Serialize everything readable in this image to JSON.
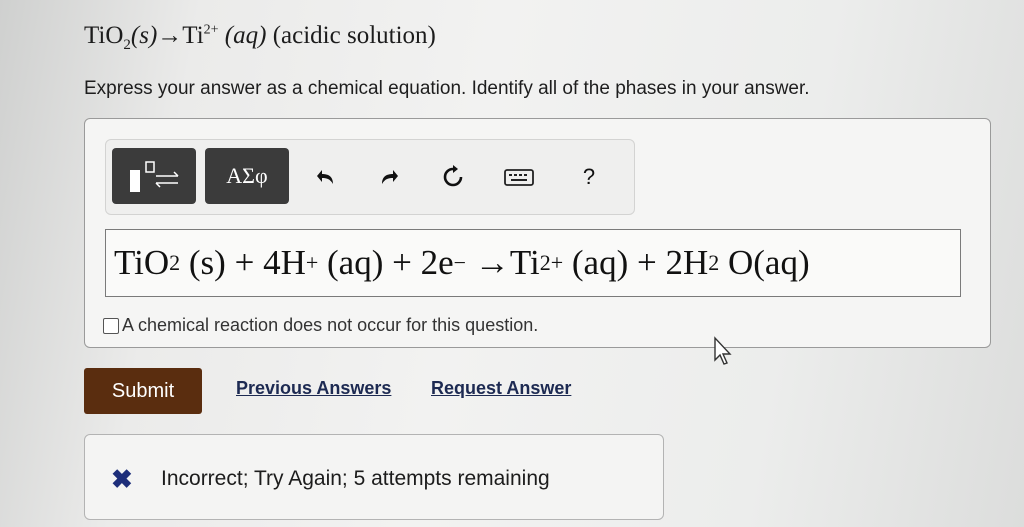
{
  "question": {
    "reactant": "TiO",
    "reactant_sub": "2",
    "reactant_phase": "(s)",
    "arrow": "→",
    "product": "Ti",
    "product_charge": "2+",
    "product_phase": "(aq)",
    "condition": "(acidic solution)"
  },
  "instruction": "Express your answer as a chemical equation. Identify all of the phases in your answer.",
  "toolbar": {
    "symbols_label": "ΑΣφ",
    "undo_icon": "undo-icon",
    "redo_icon": "redo-icon",
    "reset_icon": "reset-icon",
    "keyboard_icon": "keyboard-icon",
    "help_label": "?"
  },
  "answer": {
    "t1": "TiO",
    "t1_sub": "2",
    "t2": " (s) + 4H",
    "t2_sup": "+",
    "t3": " (aq) + 2e",
    "t3_sup": "−",
    "t4": " →Ti",
    "t4_sup": "2+",
    "t5": " (aq) + 2H",
    "t5_sub": "2",
    "t6": " O(aq)"
  },
  "no_reaction_label": "A chemical reaction does not occur for this question.",
  "buttons": {
    "submit": "Submit",
    "previous_answers": "Previous Answers",
    "request_answer": "Request Answer"
  },
  "feedback": {
    "icon": "x-icon",
    "text": "Incorrect; Try Again; 5 attempts remaining"
  },
  "colors": {
    "submit_bg": "#5a2d0f",
    "link": "#1d2a52",
    "feedback_icon": "#1d2e7a"
  }
}
